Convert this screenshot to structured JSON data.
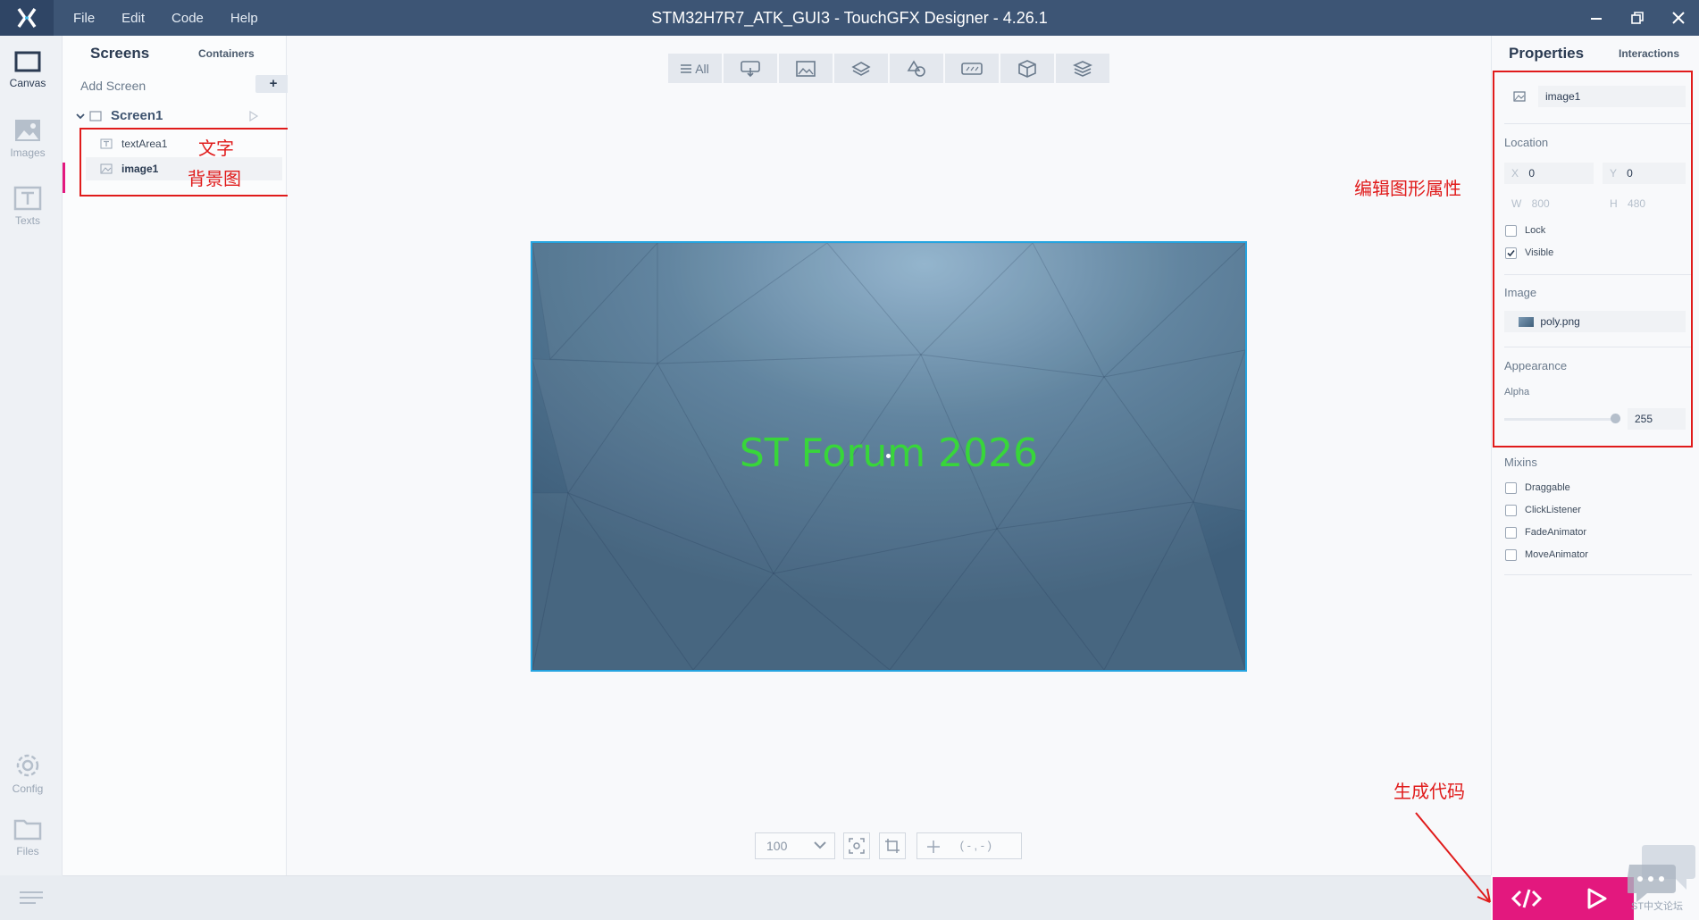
{
  "window": {
    "title": "STM32H7R7_ATK_GUI3 - TouchGFX Designer - 4.26.1",
    "menu": [
      "File",
      "Edit",
      "Code",
      "Help"
    ]
  },
  "rail": {
    "items": [
      {
        "label": "Canvas",
        "icon": "canvas-icon",
        "active": true
      },
      {
        "label": "Images",
        "icon": "image-icon"
      },
      {
        "label": "Texts",
        "icon": "text-icon"
      },
      {
        "label": "Config",
        "icon": "gear-icon"
      },
      {
        "label": "Files",
        "icon": "folder-icon"
      }
    ]
  },
  "screens_panel": {
    "tab_screens": "Screens",
    "tab_containers": "Containers",
    "add_screen": "Add Screen",
    "add_symbol": "+",
    "screen_name": "Screen1",
    "widgets": [
      {
        "name": "textArea1",
        "icon": "text-widget-icon",
        "annotation": "文字"
      },
      {
        "name": "image1",
        "icon": "image-widget-icon",
        "annotation": "背景图",
        "selected": true
      }
    ]
  },
  "toolbar": {
    "all_label": "All",
    "filters": [
      "interaction-icon",
      "image-icon",
      "container-icon",
      "shapes-icon",
      "text-widget-icon",
      "3d-icon",
      "layers-icon"
    ]
  },
  "canvas": {
    "text": "ST Forum 2026",
    "text_color": "#38d63a",
    "border_color": "#25a4e0"
  },
  "bottom": {
    "zoom": "100",
    "coords": "( - , - )"
  },
  "properties": {
    "tab_properties": "Properties",
    "tab_interactions": "Interactions",
    "widget_name": "image1",
    "location_label": "Location",
    "x_label": "X",
    "x_value": "0",
    "y_label": "Y",
    "y_value": "0",
    "w_label": "W",
    "w_value": "800",
    "h_label": "H",
    "h_value": "480",
    "lock_label": "Lock",
    "visible_label": "Visible",
    "image_label": "Image",
    "image_file": "poly.png",
    "appearance_label": "Appearance",
    "alpha_label": "Alpha",
    "alpha_value": "255",
    "mixins_label": "Mixins",
    "mixins": [
      "Draggable",
      "ClickListener",
      "FadeAnimator",
      "MoveAnimator"
    ]
  },
  "annotations": {
    "edit_props": "编辑图形属性",
    "generate_code": "生成代码",
    "color": "#e01b1b"
  },
  "watermark": "ST中文论坛",
  "colors": {
    "titlebar": "#3d5575",
    "accent": "#e3187e"
  }
}
